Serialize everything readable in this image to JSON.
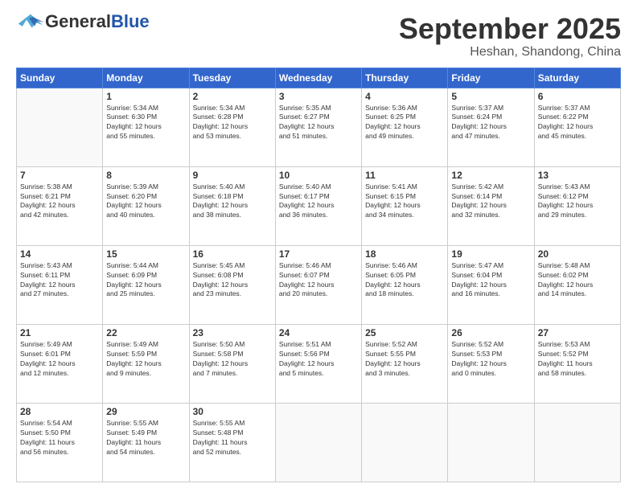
{
  "header": {
    "logo_general": "General",
    "logo_blue": "Blue",
    "month": "September 2025",
    "location": "Heshan, Shandong, China"
  },
  "weekdays": [
    "Sunday",
    "Monday",
    "Tuesday",
    "Wednesday",
    "Thursday",
    "Friday",
    "Saturday"
  ],
  "weeks": [
    [
      {
        "day": "",
        "info": ""
      },
      {
        "day": "1",
        "info": "Sunrise: 5:34 AM\nSunset: 6:30 PM\nDaylight: 12 hours\nand 55 minutes."
      },
      {
        "day": "2",
        "info": "Sunrise: 5:34 AM\nSunset: 6:28 PM\nDaylight: 12 hours\nand 53 minutes."
      },
      {
        "day": "3",
        "info": "Sunrise: 5:35 AM\nSunset: 6:27 PM\nDaylight: 12 hours\nand 51 minutes."
      },
      {
        "day": "4",
        "info": "Sunrise: 5:36 AM\nSunset: 6:25 PM\nDaylight: 12 hours\nand 49 minutes."
      },
      {
        "day": "5",
        "info": "Sunrise: 5:37 AM\nSunset: 6:24 PM\nDaylight: 12 hours\nand 47 minutes."
      },
      {
        "day": "6",
        "info": "Sunrise: 5:37 AM\nSunset: 6:22 PM\nDaylight: 12 hours\nand 45 minutes."
      }
    ],
    [
      {
        "day": "7",
        "info": "Sunrise: 5:38 AM\nSunset: 6:21 PM\nDaylight: 12 hours\nand 42 minutes."
      },
      {
        "day": "8",
        "info": "Sunrise: 5:39 AM\nSunset: 6:20 PM\nDaylight: 12 hours\nand 40 minutes."
      },
      {
        "day": "9",
        "info": "Sunrise: 5:40 AM\nSunset: 6:18 PM\nDaylight: 12 hours\nand 38 minutes."
      },
      {
        "day": "10",
        "info": "Sunrise: 5:40 AM\nSunset: 6:17 PM\nDaylight: 12 hours\nand 36 minutes."
      },
      {
        "day": "11",
        "info": "Sunrise: 5:41 AM\nSunset: 6:15 PM\nDaylight: 12 hours\nand 34 minutes."
      },
      {
        "day": "12",
        "info": "Sunrise: 5:42 AM\nSunset: 6:14 PM\nDaylight: 12 hours\nand 32 minutes."
      },
      {
        "day": "13",
        "info": "Sunrise: 5:43 AM\nSunset: 6:12 PM\nDaylight: 12 hours\nand 29 minutes."
      }
    ],
    [
      {
        "day": "14",
        "info": "Sunrise: 5:43 AM\nSunset: 6:11 PM\nDaylight: 12 hours\nand 27 minutes."
      },
      {
        "day": "15",
        "info": "Sunrise: 5:44 AM\nSunset: 6:09 PM\nDaylight: 12 hours\nand 25 minutes."
      },
      {
        "day": "16",
        "info": "Sunrise: 5:45 AM\nSunset: 6:08 PM\nDaylight: 12 hours\nand 23 minutes."
      },
      {
        "day": "17",
        "info": "Sunrise: 5:46 AM\nSunset: 6:07 PM\nDaylight: 12 hours\nand 20 minutes."
      },
      {
        "day": "18",
        "info": "Sunrise: 5:46 AM\nSunset: 6:05 PM\nDaylight: 12 hours\nand 18 minutes."
      },
      {
        "day": "19",
        "info": "Sunrise: 5:47 AM\nSunset: 6:04 PM\nDaylight: 12 hours\nand 16 minutes."
      },
      {
        "day": "20",
        "info": "Sunrise: 5:48 AM\nSunset: 6:02 PM\nDaylight: 12 hours\nand 14 minutes."
      }
    ],
    [
      {
        "day": "21",
        "info": "Sunrise: 5:49 AM\nSunset: 6:01 PM\nDaylight: 12 hours\nand 12 minutes."
      },
      {
        "day": "22",
        "info": "Sunrise: 5:49 AM\nSunset: 5:59 PM\nDaylight: 12 hours\nand 9 minutes."
      },
      {
        "day": "23",
        "info": "Sunrise: 5:50 AM\nSunset: 5:58 PM\nDaylight: 12 hours\nand 7 minutes."
      },
      {
        "day": "24",
        "info": "Sunrise: 5:51 AM\nSunset: 5:56 PM\nDaylight: 12 hours\nand 5 minutes."
      },
      {
        "day": "25",
        "info": "Sunrise: 5:52 AM\nSunset: 5:55 PM\nDaylight: 12 hours\nand 3 minutes."
      },
      {
        "day": "26",
        "info": "Sunrise: 5:52 AM\nSunset: 5:53 PM\nDaylight: 12 hours\nand 0 minutes."
      },
      {
        "day": "27",
        "info": "Sunrise: 5:53 AM\nSunset: 5:52 PM\nDaylight: 11 hours\nand 58 minutes."
      }
    ],
    [
      {
        "day": "28",
        "info": "Sunrise: 5:54 AM\nSunset: 5:50 PM\nDaylight: 11 hours\nand 56 minutes."
      },
      {
        "day": "29",
        "info": "Sunrise: 5:55 AM\nSunset: 5:49 PM\nDaylight: 11 hours\nand 54 minutes."
      },
      {
        "day": "30",
        "info": "Sunrise: 5:55 AM\nSunset: 5:48 PM\nDaylight: 11 hours\nand 52 minutes."
      },
      {
        "day": "",
        "info": ""
      },
      {
        "day": "",
        "info": ""
      },
      {
        "day": "",
        "info": ""
      },
      {
        "day": "",
        "info": ""
      }
    ]
  ]
}
